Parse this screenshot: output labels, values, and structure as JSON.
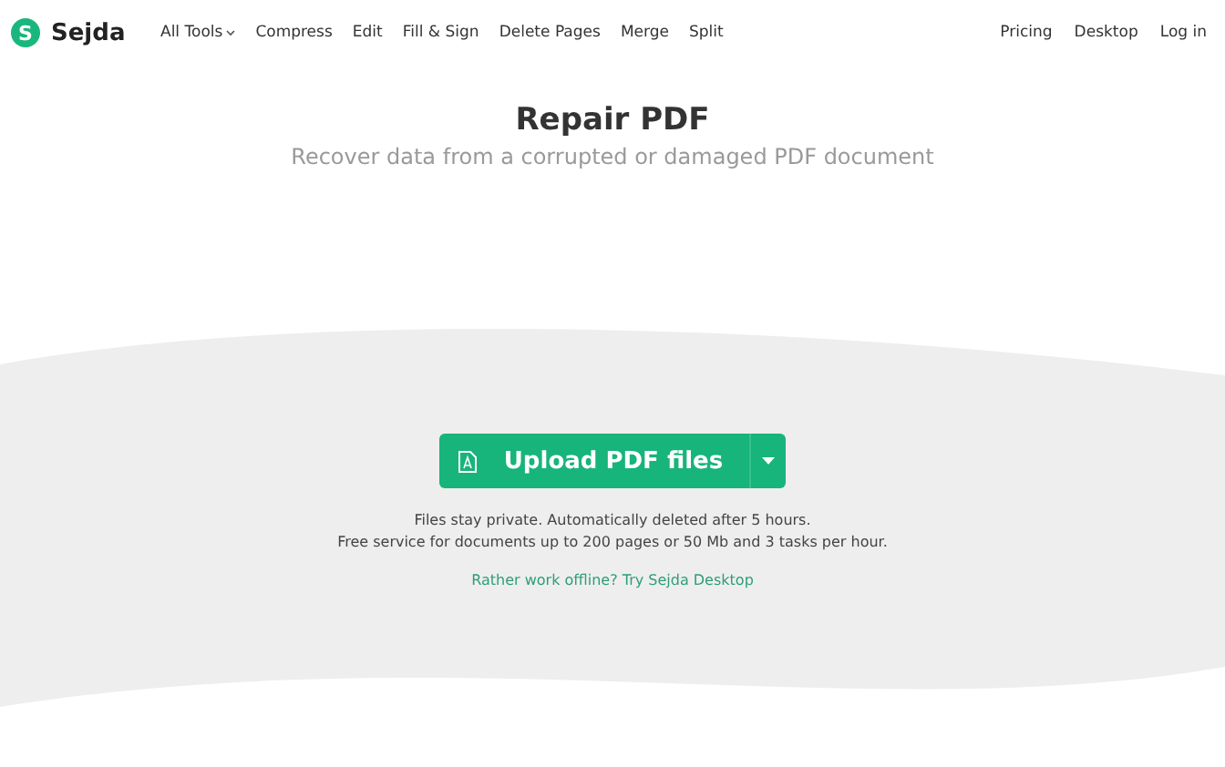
{
  "logo": {
    "letter": "S",
    "name": "Sejda"
  },
  "nav": [
    {
      "label": "All Tools",
      "dropdown": true
    },
    {
      "label": "Compress",
      "dropdown": false
    },
    {
      "label": "Edit",
      "dropdown": false
    },
    {
      "label": "Fill & Sign",
      "dropdown": false
    },
    {
      "label": "Delete Pages",
      "dropdown": false
    },
    {
      "label": "Merge",
      "dropdown": false
    },
    {
      "label": "Split",
      "dropdown": false
    }
  ],
  "nav_right": [
    "Pricing",
    "Desktop",
    "Log in"
  ],
  "title": "Repair PDF",
  "subtitle": "Recover data from a corrupted or damaged PDF document",
  "upload_button": {
    "label": "Upload PDF files"
  },
  "notes": [
    "Files stay private. Automatically deleted after 5 hours.",
    "Free service for documents up to 200 pages or 50 Mb and 3 tasks per hour."
  ],
  "desktop_link": "Rather work offline? Try Sejda Desktop"
}
